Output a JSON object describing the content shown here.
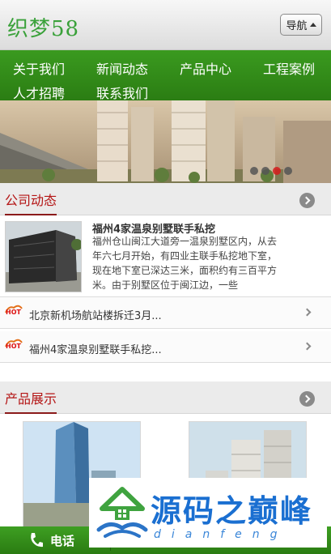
{
  "header": {
    "logo": "织梦58",
    "nav_label": "导航"
  },
  "menu": [
    "关于我们",
    "新闻动态",
    "产品中心",
    "工程案例",
    "人才招聘",
    "联系我们"
  ],
  "banner": {
    "slides": 4,
    "active": 2
  },
  "news_section": {
    "title": "公司动态"
  },
  "news_top": {
    "title": "福州4家温泉别墅联手私挖",
    "text": "福州仓山闽江大道旁一温泉别墅区内，从去年六七月开始，有四业主联手私挖地下室，现在地下室已深达三米，面积约有三百平方米。由于别墅区位于闽江边，一些"
  },
  "news_list": [
    {
      "badge": "HOT",
      "text": "北京新机场航站楼拆迁3月..."
    },
    {
      "badge": "HOT",
      "text": "福州4家温泉别墅联手私挖..."
    }
  ],
  "product_section": {
    "title": "产品展示"
  },
  "footer": {
    "phone_label": "电话"
  },
  "watermark": {
    "title": "源码之巅峰",
    "subtitle": "dianfeng"
  },
  "colors": {
    "brand_green": "#2e8416",
    "accent_red": "#b41414"
  }
}
